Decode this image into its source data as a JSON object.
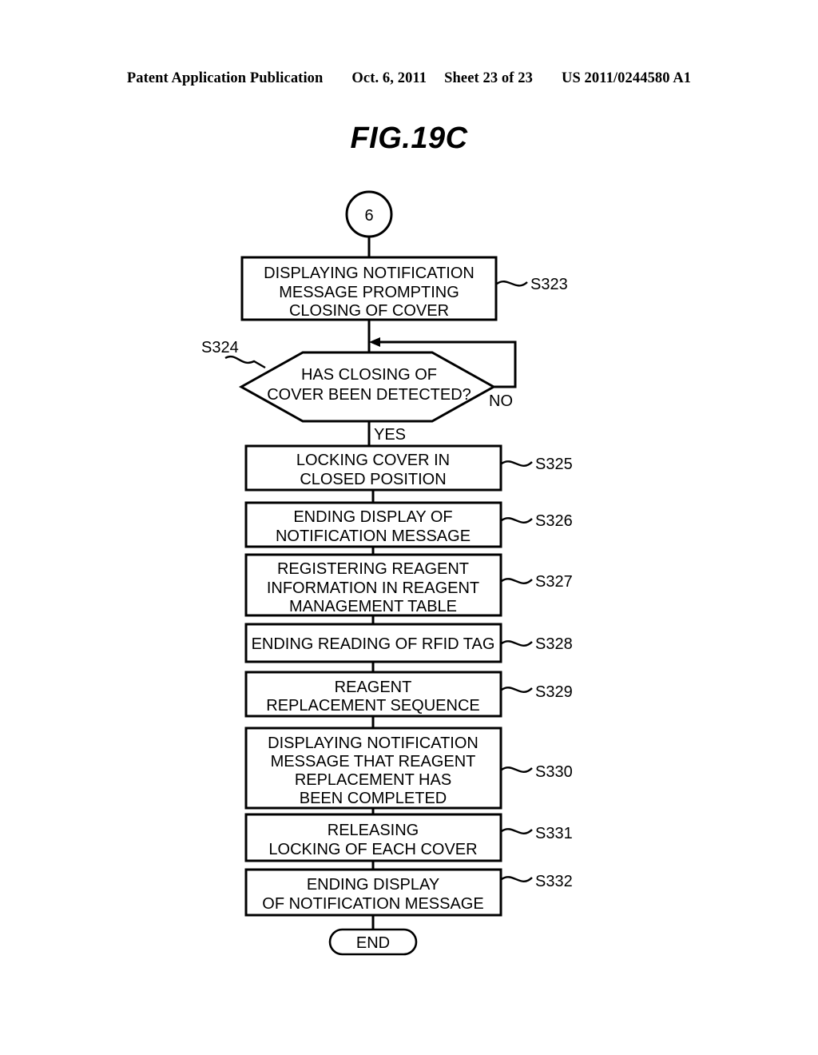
{
  "header": {
    "publication": "Patent Application Publication",
    "date": "Oct. 6, 2011",
    "sheet": "Sheet 23 of 23",
    "patent_number": "US 2011/0244580 A1"
  },
  "figure": {
    "title": "FIG.19C"
  },
  "chart_data": {
    "type": "diagram",
    "diagram_kind": "flowchart",
    "title": "FIG.19C",
    "orientation": "top-to-bottom",
    "nodes": [
      {
        "id": "conn6",
        "shape": "circle",
        "text": "6",
        "step": ""
      },
      {
        "id": "S323",
        "shape": "process",
        "text": "DISPLAYING NOTIFICATION\nMESSAGE PROMPTING\nCLOSING OF COVER",
        "lines": [
          "DISPLAYING NOTIFICATION",
          "MESSAGE PROMPTING",
          "CLOSING OF COVER"
        ],
        "step": "S323"
      },
      {
        "id": "S324",
        "shape": "decision",
        "text": "HAS CLOSING OF\nCOVER BEEN DETECTED?",
        "lines": [
          "HAS CLOSING OF",
          "COVER BEEN DETECTED?"
        ],
        "step": "S324",
        "branches": [
          "YES",
          "NO"
        ]
      },
      {
        "id": "S325",
        "shape": "process",
        "text": "LOCKING COVER IN\nCLOSED POSITION",
        "lines": [
          "LOCKING COVER IN",
          "CLOSED POSITION"
        ],
        "step": "S325"
      },
      {
        "id": "S326",
        "shape": "process",
        "text": "ENDING DISPLAY OF\nNOTIFICATION MESSAGE",
        "lines": [
          "ENDING DISPLAY OF",
          "NOTIFICATION MESSAGE"
        ],
        "step": "S326"
      },
      {
        "id": "S327",
        "shape": "process",
        "text": "REGISTERING REAGENT\nINFORMATION IN REAGENT\nMANAGEMENT TABLE",
        "lines": [
          "REGISTERING REAGENT",
          "INFORMATION IN REAGENT",
          "MANAGEMENT TABLE"
        ],
        "step": "S327"
      },
      {
        "id": "S328",
        "shape": "process",
        "text": "ENDING READING OF RFID TAG",
        "lines": [
          "ENDING READING OF RFID TAG"
        ],
        "step": "S328"
      },
      {
        "id": "S329",
        "shape": "process",
        "text": "REAGENT\nREPLACEMENT SEQUENCE",
        "lines": [
          "REAGENT",
          "REPLACEMENT SEQUENCE"
        ],
        "step": "S329"
      },
      {
        "id": "S330",
        "shape": "process",
        "text": "DISPLAYING NOTIFICATION\nMESSAGE THAT REAGENT\nREPLACEMENT HAS\nBEEN COMPLETED",
        "lines": [
          "DISPLAYING NOTIFICATION",
          "MESSAGE THAT REAGENT",
          "REPLACEMENT HAS",
          "BEEN COMPLETED"
        ],
        "step": "S330"
      },
      {
        "id": "S331",
        "shape": "process",
        "text": "RELEASING\nLOCKING OF EACH COVER",
        "lines": [
          "RELEASING",
          "LOCKING OF EACH COVER"
        ],
        "step": "S331"
      },
      {
        "id": "S332",
        "shape": "process",
        "text": "ENDING DISPLAY\nOF NOTIFICATION MESSAGE",
        "lines": [
          "ENDING DISPLAY",
          "OF NOTIFICATION MESSAGE"
        ],
        "step": "S332"
      },
      {
        "id": "END",
        "shape": "terminator",
        "text": "END",
        "step": ""
      }
    ],
    "edges": [
      {
        "from": "conn6",
        "to": "S323",
        "label": ""
      },
      {
        "from": "S323",
        "to": "S324",
        "label": ""
      },
      {
        "from": "S324",
        "to": "S325",
        "label": "YES"
      },
      {
        "from": "S324",
        "to": "S324",
        "label": "NO"
      },
      {
        "from": "S325",
        "to": "S326",
        "label": ""
      },
      {
        "from": "S326",
        "to": "S327",
        "label": ""
      },
      {
        "from": "S327",
        "to": "S328",
        "label": ""
      },
      {
        "from": "S328",
        "to": "S329",
        "label": ""
      },
      {
        "from": "S329",
        "to": "S330",
        "label": ""
      },
      {
        "from": "S330",
        "to": "S331",
        "label": ""
      },
      {
        "from": "S331",
        "to": "S332",
        "label": ""
      },
      {
        "from": "S332",
        "to": "END",
        "label": ""
      }
    ]
  },
  "flow": {
    "connector_in": "6",
    "end_label": "END",
    "branch_yes": "YES",
    "branch_no": "NO",
    "s323": {
      "l1": "DISPLAYING NOTIFICATION",
      "l2": "MESSAGE PROMPTING",
      "l3": "CLOSING OF COVER",
      "step": "S323"
    },
    "s324": {
      "l1": "HAS CLOSING OF",
      "l2": "COVER BEEN DETECTED?",
      "step": "S324"
    },
    "s325": {
      "l1": "LOCKING COVER IN",
      "l2": "CLOSED POSITION",
      "step": "S325"
    },
    "s326": {
      "l1": "ENDING DISPLAY OF",
      "l2": "NOTIFICATION MESSAGE",
      "step": "S326"
    },
    "s327": {
      "l1": "REGISTERING REAGENT",
      "l2": "INFORMATION IN REAGENT",
      "l3": "MANAGEMENT TABLE",
      "step": "S327"
    },
    "s328": {
      "l1": "ENDING READING OF RFID TAG",
      "step": "S328"
    },
    "s329": {
      "l1": "REAGENT",
      "l2": "REPLACEMENT SEQUENCE",
      "step": "S329"
    },
    "s330": {
      "l1": "DISPLAYING NOTIFICATION",
      "l2": "MESSAGE THAT REAGENT",
      "l3": "REPLACEMENT HAS",
      "l4": "BEEN COMPLETED",
      "step": "S330"
    },
    "s331": {
      "l1": "RELEASING",
      "l2": "LOCKING OF EACH COVER",
      "step": "S331"
    },
    "s332": {
      "l1": "ENDING DISPLAY",
      "l2": "OF NOTIFICATION MESSAGE",
      "step": "S332"
    }
  }
}
